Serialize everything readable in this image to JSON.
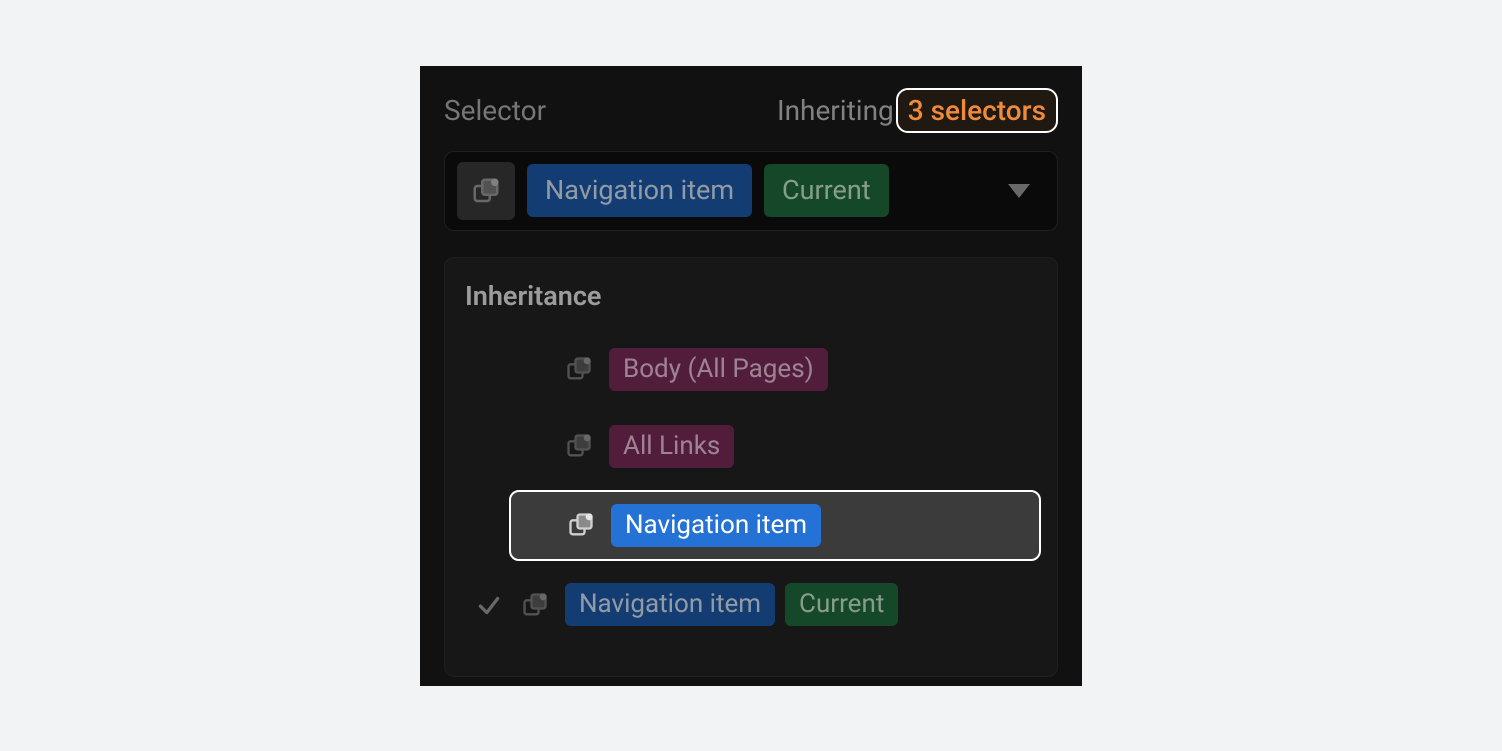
{
  "header": {
    "selector_label": "Selector",
    "inheriting_label": "Inheriting",
    "count_label": "3 selectors"
  },
  "selector_row": {
    "class_tag": "Navigation item",
    "state_tag": "Current"
  },
  "inheritance": {
    "title": "Inheritance",
    "rows": [
      {
        "checked": false,
        "tags": [
          {
            "text": "Body (All Pages)",
            "color": "pink"
          }
        ],
        "highlight": false
      },
      {
        "checked": false,
        "tags": [
          {
            "text": "All Links",
            "color": "pink"
          }
        ],
        "highlight": false
      },
      {
        "checked": false,
        "tags": [
          {
            "text": "Navigation item",
            "color": "blue-bright"
          }
        ],
        "highlight": true
      },
      {
        "checked": true,
        "tags": [
          {
            "text": "Navigation item",
            "color": "blue"
          },
          {
            "text": "Current",
            "color": "green"
          }
        ],
        "highlight": false
      }
    ]
  }
}
